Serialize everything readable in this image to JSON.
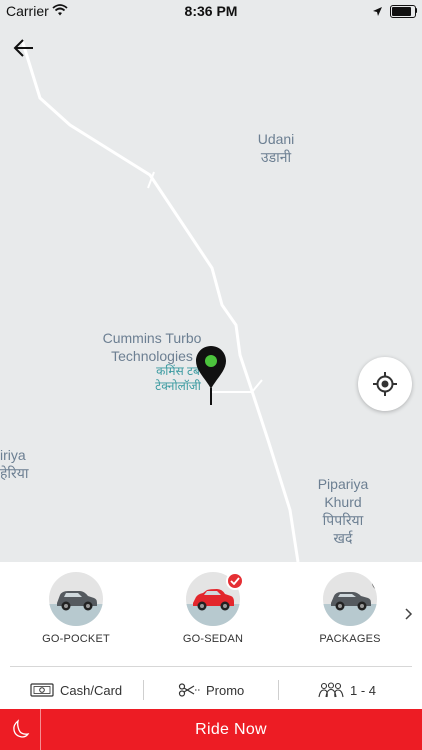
{
  "status_bar": {
    "carrier": "Carrier",
    "time": "8:36 PM"
  },
  "map": {
    "labels": [
      {
        "id": "udani",
        "en": "Udani",
        "local": "उडानी"
      },
      {
        "id": "cummins",
        "en_line1": "Cummins Turbo",
        "en_line2": "Technologies",
        "local_line1": "कमिंस टब",
        "local_line2": "टेक्नोलॉजी"
      },
      {
        "id": "left-edge",
        "en": "iriya",
        "local": "हेरिया"
      },
      {
        "id": "pipariya",
        "en_line1": "Pipariya",
        "en_line2": "Khurd",
        "local_line1": "पिपरिया",
        "local_line2": "खर्द"
      }
    ]
  },
  "cab_types": [
    {
      "label": "GO-POCKET",
      "selected": false,
      "car_color": "#555a5f"
    },
    {
      "label": "GO-SEDAN",
      "selected": true,
      "car_color": "#e3262c"
    },
    {
      "label": "PACKAGES",
      "selected": false,
      "car_color": "#555a5f"
    }
  ],
  "options": {
    "payment": "Cash/Card",
    "promo": "Promo",
    "seats": "1 - 4"
  },
  "ride_now_label": "Ride Now",
  "colors": {
    "accent": "#ed1c24",
    "map_bg": "#e8eaeb"
  }
}
